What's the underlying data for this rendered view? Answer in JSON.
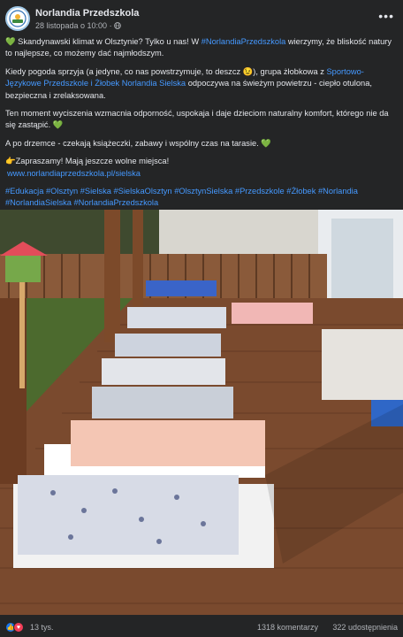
{
  "post": {
    "page_name": "Norlandia Przedszkola",
    "timestamp": "28 listopada o 10:00",
    "audience_separator": " · ",
    "paragraph1_a": " Skandynawski klimat w Olsztynie? Tylko u nas! W ",
    "paragraph1_hashtag": "#NorlandiaPrzedszkola",
    "paragraph1_b": " wierzymy, że bliskość natury to najlepsze, co możemy dać najmłodszym.",
    "paragraph2_a": "Kiedy pogoda sprzyja (a jedyne, co nas powstrzymuje, to deszcz 😉), grupa żłobkowa z ",
    "paragraph2_link": "Sportowo-Językowe Przedszkole i Żłobek Norlandia Sielska",
    "paragraph2_b": " odpoczywa na świeżym powietrzu - ciepło otulona, bezpieczna i zrelaksowana.",
    "paragraph3": "Ten moment wyciszenia wzmacnia odporność, uspokaja i daje dzieciom naturalny komfort, którego nie da się zastąpić.",
    "paragraph4": "A po drzemce - czekają książeczki, zabawy i wspólny czas na tarasie.",
    "paragraph5": "👉Zapraszamy! Mają jeszcze wolne miejsca!",
    "website_link": "www.norlandiaprzedszkola.pl/sielska",
    "hashtags": "#Edukacja #Olsztyn #Sielska #SielskaOlsztyn #OlsztynSielska #Przedszkole #Żłobek #Norlandia #NorlandiaSielska #NorlandiaPrzedszkola"
  },
  "engagement": {
    "reactions": "13 tys.",
    "comments": "1318 komentarzy",
    "shares": "322 udostępnienia"
  },
  "icons": {
    "heart": "green-heart-icon",
    "globe": "globe-icon",
    "more": "more-options-icon",
    "like": "like-reaction-icon",
    "love": "love-reaction-icon"
  },
  "colors": {
    "background": "#242526",
    "link": "#4599ff",
    "like": "#1877f2",
    "love": "#f33e58",
    "green_heart": "#5ac142"
  }
}
